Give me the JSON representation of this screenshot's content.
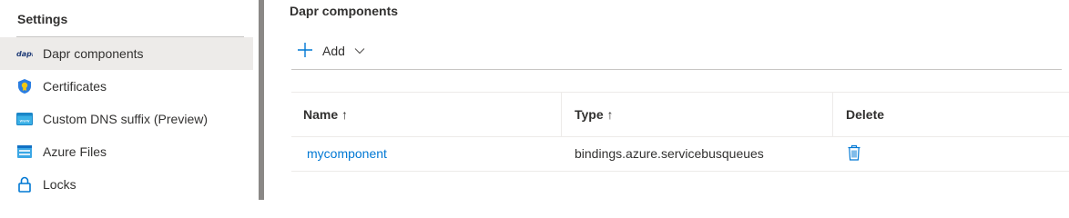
{
  "sidebar": {
    "header": "Settings",
    "items": [
      {
        "label": "Dapr components",
        "icon": "dapr-icon",
        "selected": true
      },
      {
        "label": "Certificates",
        "icon": "certificate-icon",
        "selected": false
      },
      {
        "label": "Custom DNS suffix (Preview)",
        "icon": "dns-icon",
        "selected": false
      },
      {
        "label": "Azure Files",
        "icon": "azure-files-icon",
        "selected": false
      },
      {
        "label": "Locks",
        "icon": "lock-icon",
        "selected": false
      }
    ]
  },
  "main": {
    "title": "Dapr components",
    "toolbar": {
      "add_label": "Add"
    },
    "grid": {
      "columns": [
        {
          "label": "Name ↑",
          "sort": "ascending"
        },
        {
          "label": "Type ↑",
          "sort": "ascending"
        },
        {
          "label": "Delete"
        }
      ],
      "rows": [
        {
          "name": "mycomponent",
          "type": "bindings.azure.servicebusqueues"
        }
      ]
    }
  },
  "colors": {
    "accent": "#0078d4",
    "selected_bg": "#edebe9",
    "divider": "#8a8886"
  }
}
